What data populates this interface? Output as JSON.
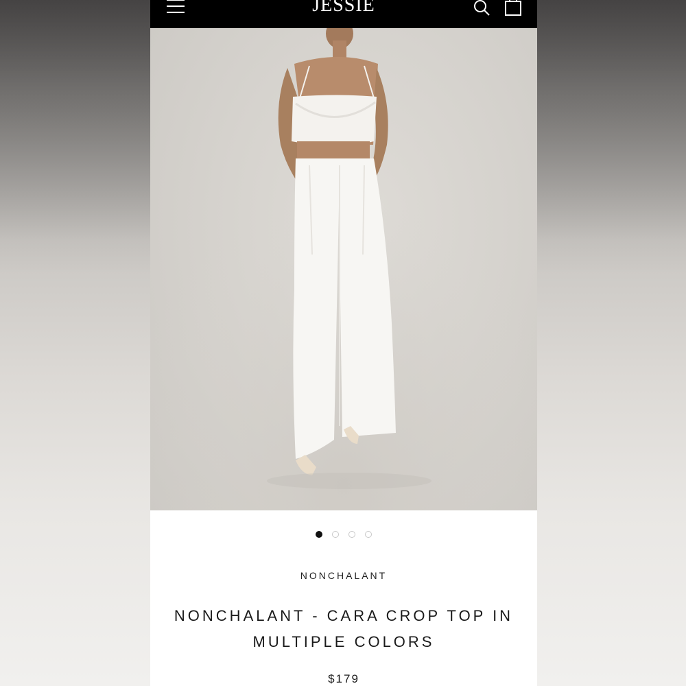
{
  "header": {
    "logo": "JESSIE",
    "icons": [
      "menu-icon",
      "search-icon",
      "cart-icon"
    ]
  },
  "gallery": {
    "image_description_icon": "product-photo",
    "slide_count": 4,
    "active_slide": 1
  },
  "product": {
    "vendor": "NONCHALANT",
    "title_line1": "NONCHALANT - CARA CROP TOP IN",
    "title_line2": "MULTIPLE COLORS",
    "price": "$179"
  },
  "colors": {
    "topbar": "#000000",
    "accent_dot": "#111111"
  }
}
